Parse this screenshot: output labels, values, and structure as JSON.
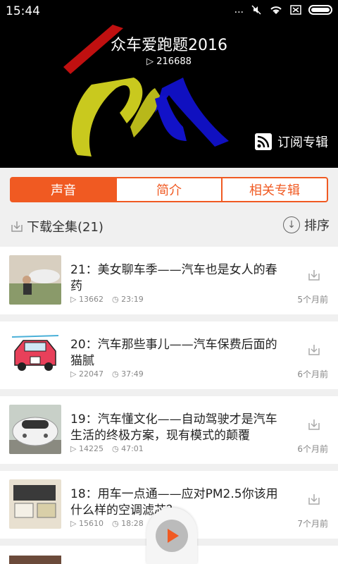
{
  "status": {
    "time": "15:44",
    "extra": "..."
  },
  "album": {
    "title": "众车爱跑题2016",
    "play_count": "216688",
    "subscribe_label": "订阅专辑"
  },
  "tabs": [
    {
      "label": "声音",
      "active": true
    },
    {
      "label": "简介",
      "active": false
    },
    {
      "label": "相关专辑",
      "active": false
    }
  ],
  "download": {
    "label": "下载全集(21)",
    "sort_label": "排序"
  },
  "tracks": [
    {
      "title": "21：美女聊车季——汽车也是女人的春药",
      "plays": "13662",
      "duration": "23:19",
      "date": "5个月前"
    },
    {
      "title": "20：汽车那些事儿——汽车保费后面的猫腻",
      "plays": "22047",
      "duration": "37:49",
      "date": "6个月前"
    },
    {
      "title": "19：汽车懂文化——自动驾驶才是汽车生活的终极方案，现有模式的颠覆",
      "plays": "14225",
      "duration": "47:01",
      "date": "6个月前"
    },
    {
      "title": "18：用车一点通——应对PM2.5你该用什么样的空调滤芯？",
      "plays": "15610",
      "duration": "18:28",
      "date": "7个月前"
    }
  ],
  "colors": {
    "accent": "#f05a22",
    "hero_bg": "#000000"
  }
}
